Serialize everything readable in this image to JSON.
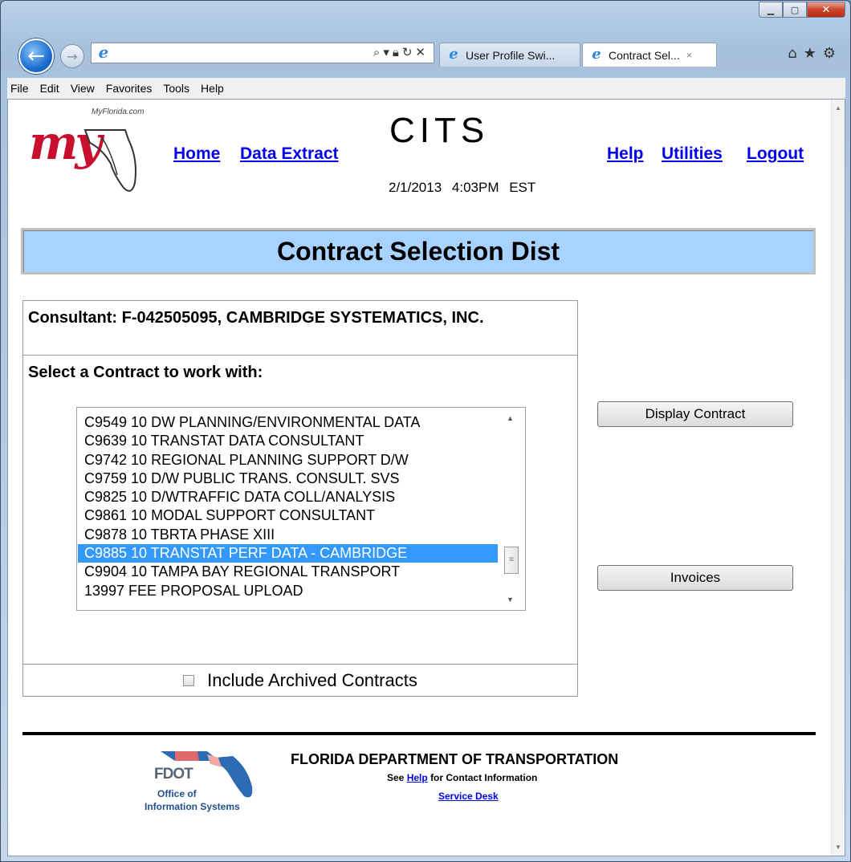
{
  "browser": {
    "tabs": [
      {
        "label": "User Profile Swi..."
      },
      {
        "label": "Contract Sel...",
        "close": "×"
      }
    ],
    "menu": [
      "File",
      "Edit",
      "View",
      "Favorites",
      "Tools",
      "Help"
    ]
  },
  "header": {
    "site": "MyFlorida.com",
    "logo_text": "my",
    "title": "CITS",
    "datetime": "2/1/2013   4:03PM EST",
    "links_left": [
      "Home",
      "Data Extract"
    ],
    "links_right": [
      "Help",
      "Utilities",
      "Logout"
    ]
  },
  "page": {
    "heading": "Contract Selection Dist",
    "consultant": "Consultant: F-042505095, CAMBRIDGE SYSTEMATICS, INC.",
    "select_label": "Select a Contract to work with:",
    "contracts": [
      "C9549 10 DW PLANNING/ENVIRONMENTAL DATA",
      "C9639 10 TRANSTAT DATA CONSULTANT",
      "C9742 10 REGIONAL PLANNING SUPPORT D/W",
      "C9759 10 D/W PUBLIC TRANS. CONSULT. SVS",
      "C9825 10 D/WTRAFFIC DATA COLL/ANALYSIS",
      "C9861 10 MODAL SUPPORT CONSULTANT",
      "C9878 10 TBRTA PHASE XIII",
      "C9885 10 TRANSTAT PERF DATA - CAMBRIDGE",
      "C9904 10 TAMPA BAY REGIONAL TRANSPORT",
      "13997 FEE PROPOSAL UPLOAD"
    ],
    "selected_index": 7,
    "archived_label": "Include Archived Contracts",
    "archived_checked": false,
    "buttons": {
      "display": "Display Contract",
      "invoices": "Invoices"
    }
  },
  "footer": {
    "logo_word": "FDOT",
    "logo_line1": "Office of",
    "logo_line2": "Information Systems",
    "department": "FLORIDA DEPARTMENT OF TRANSPORTATION",
    "see": "See",
    "help_link": "Help",
    "contact": "for Contact Information",
    "service_desk": "Service Desk"
  },
  "colors": {
    "banner": "#a8d2ff",
    "selection": "#3399ff",
    "link": "#0000ee",
    "logo_red": "#c8102e"
  }
}
